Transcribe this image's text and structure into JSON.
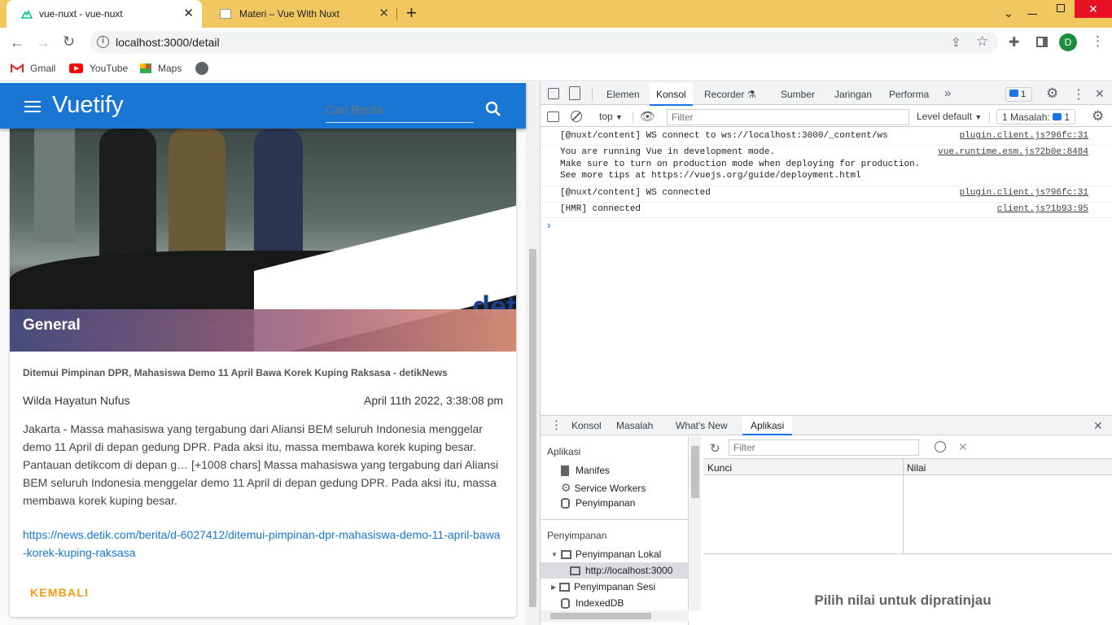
{
  "browser": {
    "tabs": [
      {
        "title": "vue-nuxt - vue-nuxt",
        "active": true
      },
      {
        "title": "Materi – Vue With Nuxt",
        "active": false
      }
    ],
    "new_tab": "+",
    "window_controls": [
      "chevron-down-icon",
      "minimize-icon",
      "restore-icon",
      "close-icon"
    ],
    "address": "localhost:3000/detail",
    "profile_initial": "D",
    "bookmarks": [
      "Gmail",
      "YouTube",
      "Maps"
    ]
  },
  "app": {
    "menu_icon": "hamburger-icon",
    "title": "Vuetify",
    "search_placeholder": "Cari Berita",
    "accent": "#1976d2",
    "article": {
      "category": "General",
      "image_watermark": "det",
      "headline": "Ditemui Pimpinan DPR, Mahasiswa Demo 11 April Bawa Korek Kuping Raksasa - detikNews",
      "author": "Wilda Hayatun Nufus",
      "date": "April 11th 2022, 3:38:08 pm",
      "body": "Jakarta - Massa mahasiswa yang tergabung dari Aliansi BEM seluruh Indonesia menggelar demo 11 April di depan gedung DPR. Pada aksi itu, massa membawa korek kuping besar. Pantauan detikcom di depan g… [+1008 chars] Massa mahasiswa yang tergabung dari Aliansi BEM seluruh Indonesia menggelar demo 11 April di depan gedung DPR. Pada aksi itu, massa membawa korek kuping besar.",
      "link": "https://news.detik.com/berita/d-6027412/ditemui-pimpinan-dpr-mahasiswa-demo-11-april-bawa-korek-kuping-raksasa",
      "back_button": "KEMBALI",
      "back_color": "#f39c12"
    }
  },
  "devtools": {
    "tabs": [
      "Elemen",
      "Konsol",
      "Recorder",
      "Sumber",
      "Jaringan",
      "Performa"
    ],
    "active_tab": "Konsol",
    "more": "»",
    "issues_badge": "1",
    "console_toolbar": {
      "context": "top",
      "filter_placeholder": "Filter",
      "level": "Level default",
      "issues_label": "1 Masalah:",
      "issues_count": "1"
    },
    "messages": [
      {
        "lines": [
          "[@nuxt/content] WS connect to ws://localhost:3000/_content/ws"
        ],
        "source": "plugin.client.js?96fc:31"
      },
      {
        "lines": [
          "You are running Vue in development mode.",
          "Make sure to turn on production mode when deploying for production.",
          "See more tips at https://vuejs.org/guide/deployment.html"
        ],
        "source": "vue.runtime.esm.js?2b0e:8484"
      },
      {
        "lines": [
          "[@nuxt/content] WS connected"
        ],
        "source": "plugin.client.js?96fc:31"
      },
      {
        "lines": [
          "[HMR] connected"
        ],
        "source": "client.js?1b93:95"
      }
    ],
    "prompt": "›",
    "drawer": {
      "tabs": [
        "Konsol",
        "Masalah",
        "What's New",
        "Aplikasi"
      ],
      "active": "Aplikasi",
      "sidebar": {
        "section1": "Aplikasi",
        "items1": [
          "Manifes",
          "Service Workers",
          "Penyimpanan"
        ],
        "section2": "Penyimpanan",
        "local": "Penyimpanan Lokal",
        "local_child": "http://localhost:3000",
        "session": "Penyimpanan Sesi",
        "indexeddb": "IndexedDB"
      },
      "filter_placeholder": "Filter",
      "columns": [
        "Kunci",
        "Nilai"
      ],
      "empty_message": "Pilih nilai untuk dipratinjau"
    }
  }
}
